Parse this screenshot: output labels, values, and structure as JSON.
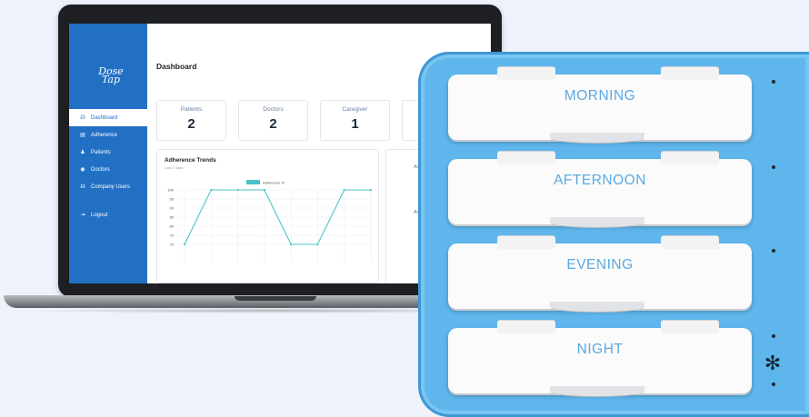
{
  "app": {
    "logo_line1": "Dose",
    "logo_line2": "Tap"
  },
  "sidebar": {
    "items": [
      {
        "label": "Dashboard",
        "icon": "☊",
        "icon_name": "dashboard-icon",
        "active": true
      },
      {
        "label": "Adherence",
        "icon": "▤",
        "icon_name": "adherence-icon",
        "active": false
      },
      {
        "label": "Patients",
        "icon": "♟",
        "icon_name": "patients-icon",
        "active": false
      },
      {
        "label": "Doctors",
        "icon": "◉",
        "icon_name": "doctors-icon",
        "active": false
      },
      {
        "label": "Company Users",
        "icon": "☊",
        "icon_name": "company-users-icon",
        "active": false
      },
      {
        "label": "Logout",
        "icon": "⇥",
        "icon_name": "logout-icon",
        "active": false
      }
    ]
  },
  "main": {
    "title": "Dashboard",
    "cards": [
      {
        "label": "Patients",
        "value": "2"
      },
      {
        "label": "Doctors",
        "value": "2"
      },
      {
        "label": "Caregiver",
        "value": "1"
      }
    ],
    "side_panel": {
      "stat1_label": "Avg",
      "stat1_value": "8",
      "stat2_label": "Avg",
      "stat2_value": "1"
    }
  },
  "chart_data": {
    "type": "line",
    "title": "Adherence Trends",
    "subtitle": "Last 7 days",
    "series": [
      {
        "name": "Adherence %",
        "color": "#4cc3c9",
        "values": [
          70,
          100,
          100,
          100,
          70,
          70,
          100,
          100
        ]
      }
    ],
    "y_ticks": [
      100,
      95,
      90,
      85,
      80,
      75,
      70
    ],
    "ylim": [
      70,
      100
    ],
    "grid": true,
    "legend_placement": "top"
  },
  "organizer": {
    "compartments": [
      "MORNING",
      "AFTERNOON",
      "EVENING",
      "NIGHT"
    ],
    "accent_color": "#5eb6ec",
    "label_color": "#5aa9e2"
  }
}
